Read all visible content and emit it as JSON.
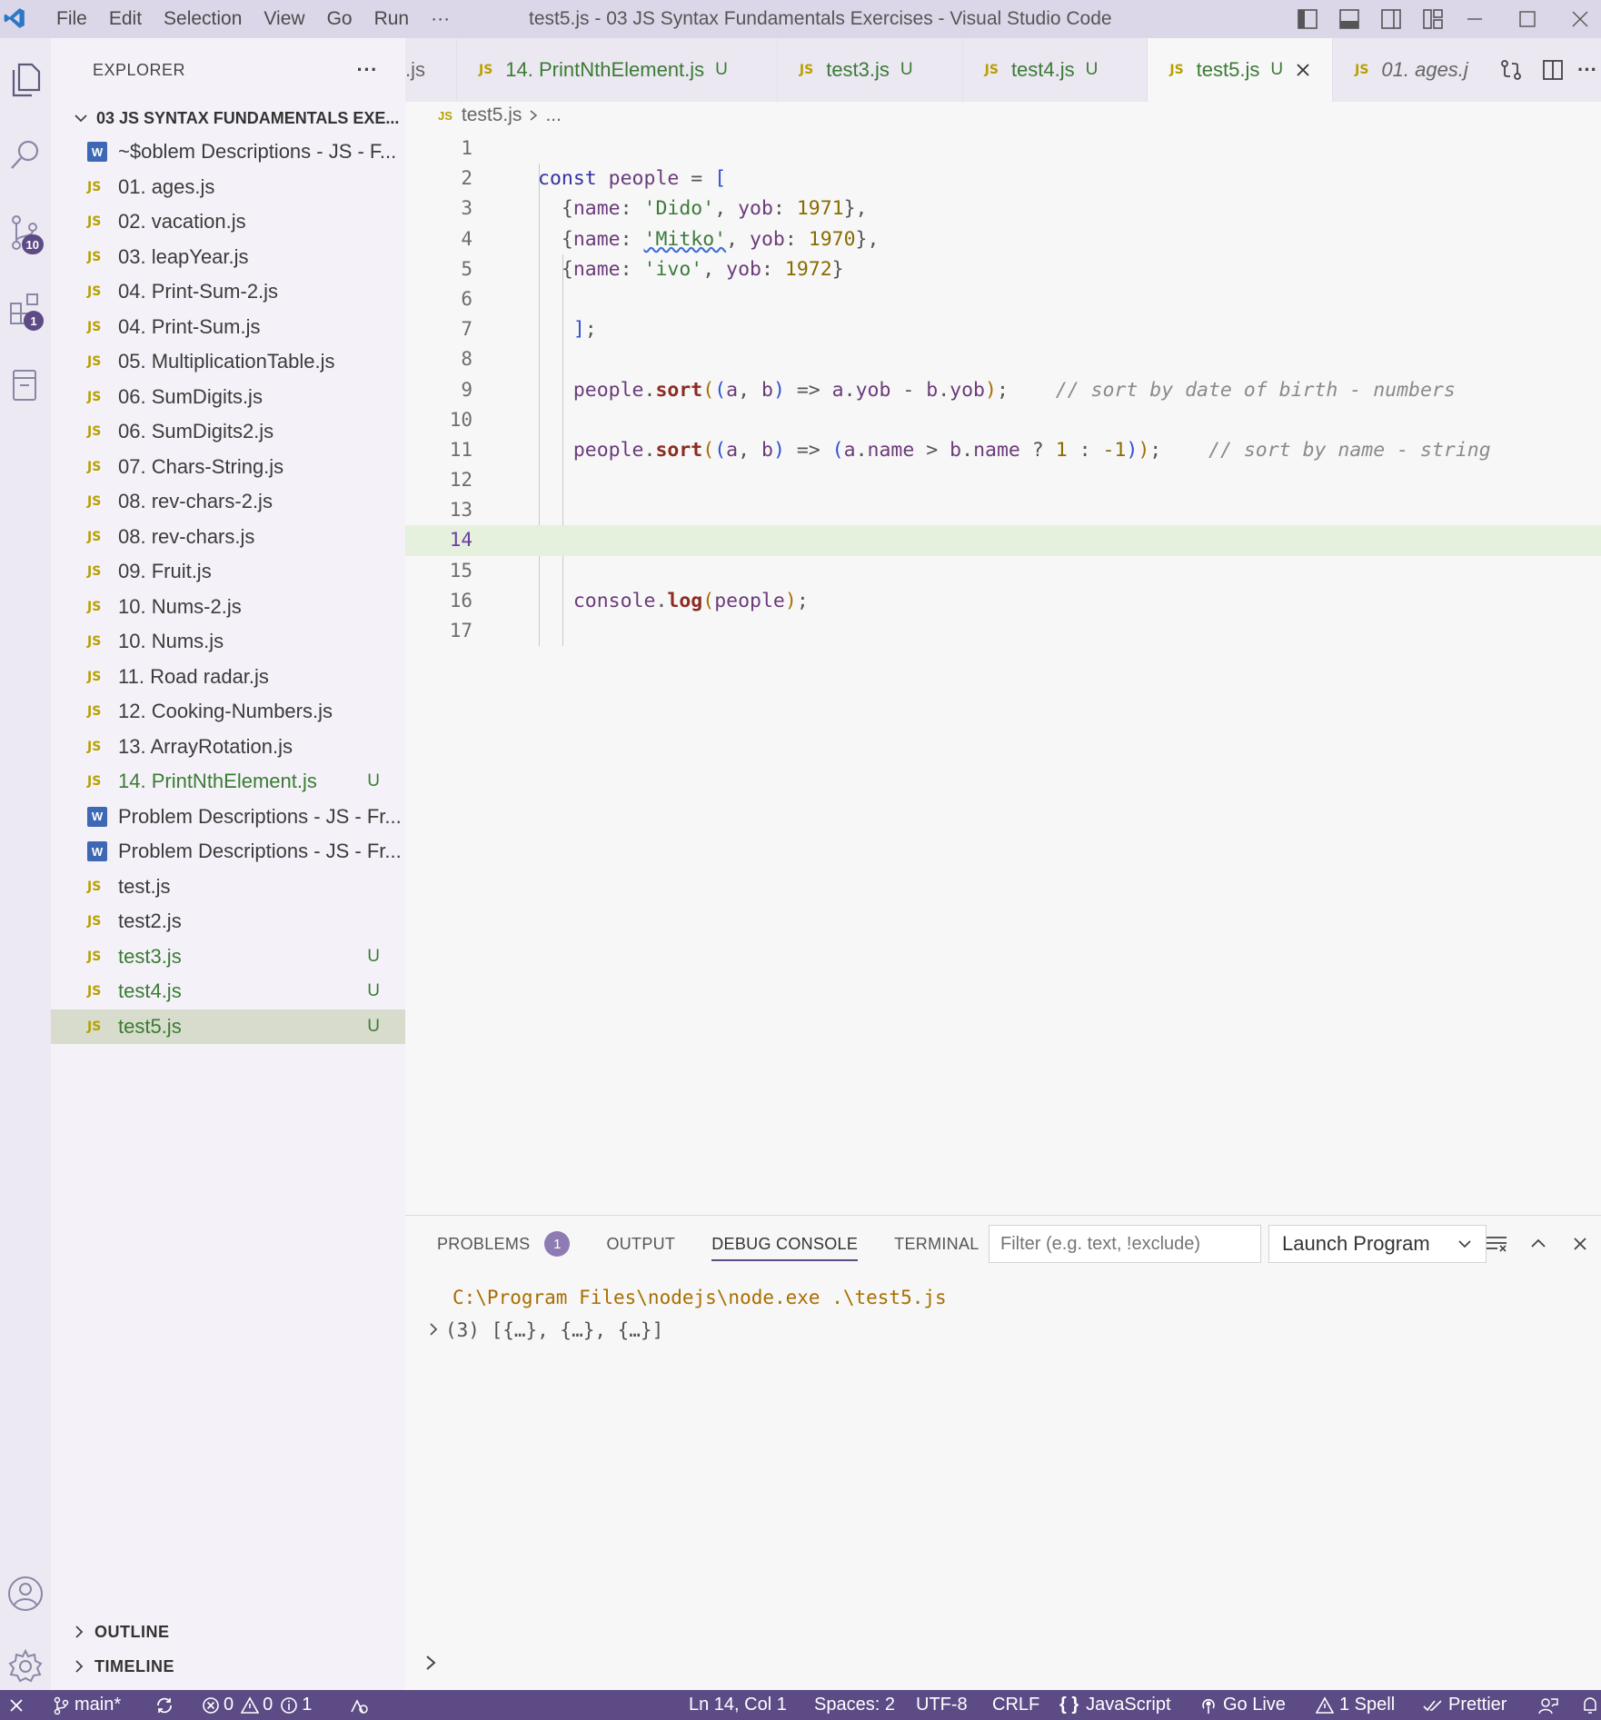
{
  "titlebar": {
    "menu": [
      "File",
      "Edit",
      "Selection",
      "View",
      "Go",
      "Run",
      "···"
    ],
    "title": "test5.js - 03 JS Syntax Fundamentals Exercises - Visual Studio Code"
  },
  "activity": {
    "scm_badge": "10",
    "extensions_badge": "1"
  },
  "sidebar": {
    "header": "EXPLORER",
    "more": "···",
    "folder": "03 JS SYNTAX FUNDAMENTALS EXE...",
    "files": [
      {
        "icon": "W",
        "name": "~$oblem Descriptions - JS - F...",
        "status": ""
      },
      {
        "icon": "JS",
        "name": "01. ages.js",
        "status": ""
      },
      {
        "icon": "JS",
        "name": "02. vacation.js",
        "status": ""
      },
      {
        "icon": "JS",
        "name": "03. leapYear.js",
        "status": ""
      },
      {
        "icon": "JS",
        "name": "04. Print-Sum-2.js",
        "status": ""
      },
      {
        "icon": "JS",
        "name": "04. Print-Sum.js",
        "status": ""
      },
      {
        "icon": "JS",
        "name": "05. MultiplicationTable.js",
        "status": ""
      },
      {
        "icon": "JS",
        "name": "06. SumDigits.js",
        "status": ""
      },
      {
        "icon": "JS",
        "name": "06. SumDigits2.js",
        "status": ""
      },
      {
        "icon": "JS",
        "name": "07. Chars-String.js",
        "status": ""
      },
      {
        "icon": "JS",
        "name": "08. rev-chars-2.js",
        "status": ""
      },
      {
        "icon": "JS",
        "name": "08. rev-chars.js",
        "status": ""
      },
      {
        "icon": "JS",
        "name": "09. Fruit.js",
        "status": ""
      },
      {
        "icon": "JS",
        "name": "10. Nums-2.js",
        "status": ""
      },
      {
        "icon": "JS",
        "name": "10. Nums.js",
        "status": ""
      },
      {
        "icon": "JS",
        "name": "11. Road radar.js",
        "status": ""
      },
      {
        "icon": "JS",
        "name": "12. Cooking-Numbers.js",
        "status": ""
      },
      {
        "icon": "JS",
        "name": "13. ArrayRotation.js",
        "status": ""
      },
      {
        "icon": "JS",
        "name": "14. PrintNthElement.js",
        "status": "U"
      },
      {
        "icon": "W",
        "name": "Problem Descriptions - JS - Fr...",
        "status": ""
      },
      {
        "icon": "W",
        "name": "Problem Descriptions - JS - Fr...",
        "status": ""
      },
      {
        "icon": "JS",
        "name": "test.js",
        "status": ""
      },
      {
        "icon": "JS",
        "name": "test2.js",
        "status": ""
      },
      {
        "icon": "JS",
        "name": "test3.js",
        "status": "U"
      },
      {
        "icon": "JS",
        "name": "test4.js",
        "status": "U"
      },
      {
        "icon": "JS",
        "name": "test5.js",
        "status": "U"
      }
    ],
    "outline": "OUTLINE",
    "timeline": "TIMELINE"
  },
  "tabs": [
    {
      "name": ".js",
      "status": "",
      "active": false,
      "italic": false,
      "icon": ""
    },
    {
      "name": "14. PrintNthElement.js",
      "status": "U",
      "active": false,
      "italic": false,
      "icon": "JS"
    },
    {
      "name": "test3.js",
      "status": "U",
      "active": false,
      "italic": false,
      "icon": "JS"
    },
    {
      "name": "test4.js",
      "status": "U",
      "active": false,
      "italic": false,
      "icon": "JS"
    },
    {
      "name": "test5.js",
      "status": "U",
      "active": true,
      "italic": false,
      "icon": "JS"
    },
    {
      "name": "01. ages.j",
      "status": "",
      "active": false,
      "italic": true,
      "icon": "JS"
    }
  ],
  "breadcrumb": {
    "file": "test5.js",
    "rest": "..."
  },
  "code": [
    {
      "n": "1",
      "tokens": []
    },
    {
      "n": "2",
      "tokens": [
        [
          "kw",
          "const "
        ],
        [
          "id",
          "people"
        ],
        [
          "pu",
          " = "
        ],
        [
          "br",
          "["
        ]
      ]
    },
    {
      "n": "3",
      "tokens": [
        [
          "pu",
          "  {"
        ],
        [
          "id",
          "name"
        ],
        [
          "pu",
          ": "
        ],
        [
          "st",
          "'Dido'"
        ],
        [
          "pu",
          ", "
        ],
        [
          "id",
          "yob"
        ],
        [
          "pu",
          ": "
        ],
        [
          "nm",
          "1971"
        ],
        [
          "pu",
          "},"
        ]
      ]
    },
    {
      "n": "4",
      "tokens": [
        [
          "pu",
          "  {"
        ],
        [
          "id",
          "name"
        ],
        [
          "pu",
          ": "
        ],
        [
          "st",
          "'Mitko'"
        ],
        [
          "pu",
          ", "
        ],
        [
          "id",
          "yob"
        ],
        [
          "pu",
          ": "
        ],
        [
          "nm",
          "1970"
        ],
        [
          "pu",
          "},"
        ]
      ]
    },
    {
      "n": "5",
      "tokens": [
        [
          "pu",
          "  {"
        ],
        [
          "id",
          "name"
        ],
        [
          "pu",
          ": "
        ],
        [
          "st",
          "'ivo'"
        ],
        [
          "pu",
          ", "
        ],
        [
          "id",
          "yob"
        ],
        [
          "pu",
          ": "
        ],
        [
          "nm",
          "1972"
        ],
        [
          "pu",
          "}"
        ]
      ]
    },
    {
      "n": "6",
      "tokens": []
    },
    {
      "n": "7",
      "tokens": [
        [
          "br",
          "   ]"
        ],
        [
          "pu",
          ";"
        ]
      ]
    },
    {
      "n": "8",
      "tokens": []
    },
    {
      "n": "9",
      "tokens": [
        [
          "id",
          "   people"
        ],
        [
          "pu",
          "."
        ],
        [
          "fn",
          "sort"
        ],
        [
          "pa",
          "("
        ],
        [
          "br",
          "("
        ],
        [
          "id",
          "a"
        ],
        [
          "pu",
          ", "
        ],
        [
          "id",
          "b"
        ],
        [
          "br",
          ")"
        ],
        [
          "pu",
          " => "
        ],
        [
          "id",
          "a"
        ],
        [
          "pu",
          "."
        ],
        [
          "id",
          "yob"
        ],
        [
          "pu",
          " - "
        ],
        [
          "id",
          "b"
        ],
        [
          "pu",
          "."
        ],
        [
          "id",
          "yob"
        ],
        [
          "pa",
          ")"
        ],
        [
          "pu",
          ";"
        ],
        [
          "cm",
          "    // sort by date of birth - numbers"
        ]
      ]
    },
    {
      "n": "10",
      "tokens": []
    },
    {
      "n": "11",
      "tokens": [
        [
          "id",
          "   people"
        ],
        [
          "pu",
          "."
        ],
        [
          "fn",
          "sort"
        ],
        [
          "pa",
          "("
        ],
        [
          "br",
          "("
        ],
        [
          "id",
          "a"
        ],
        [
          "pu",
          ", "
        ],
        [
          "id",
          "b"
        ],
        [
          "br",
          ")"
        ],
        [
          "pu",
          " => "
        ],
        [
          "br",
          "("
        ],
        [
          "id",
          "a"
        ],
        [
          "pu",
          "."
        ],
        [
          "id",
          "name"
        ],
        [
          "pu",
          " > "
        ],
        [
          "id",
          "b"
        ],
        [
          "pu",
          "."
        ],
        [
          "id",
          "name"
        ],
        [
          "pu",
          " ? "
        ],
        [
          "nm",
          "1"
        ],
        [
          "pu",
          " : "
        ],
        [
          "nm",
          "-1"
        ],
        [
          "br",
          ")"
        ],
        [
          "pa",
          ")"
        ],
        [
          "pu",
          ";"
        ],
        [
          "cm",
          "    // sort by name - string"
        ]
      ]
    },
    {
      "n": "12",
      "tokens": []
    },
    {
      "n": "13",
      "tokens": []
    },
    {
      "n": "14",
      "tokens": [],
      "current": true
    },
    {
      "n": "15",
      "tokens": []
    },
    {
      "n": "16",
      "tokens": [
        [
          "id",
          "   console"
        ],
        [
          "pu",
          "."
        ],
        [
          "fn",
          "log"
        ],
        [
          "pa",
          "("
        ],
        [
          "id",
          "people"
        ],
        [
          "pa",
          ")"
        ],
        [
          "pu",
          ";"
        ]
      ]
    },
    {
      "n": "17",
      "tokens": []
    }
  ],
  "panel": {
    "tabs": {
      "problems": "PROBLEMS",
      "problems_count": "1",
      "output": "OUTPUT",
      "debug": "DEBUG CONSOLE",
      "terminal": "TERMINAL"
    },
    "filter_placeholder": "Filter (e.g. text, !exclude)",
    "launch": "Launch Program",
    "console_cmd": "C:\\Program Files\\nodejs\\node.exe .\\test5.js",
    "console_out": "(3) [{…}, {…}, {…}]"
  },
  "status": {
    "branch": "main*",
    "errors": "0",
    "warnings": "0",
    "info": "1",
    "position": "Ln 14, Col 1",
    "spaces": "Spaces: 2",
    "encoding": "UTF-8",
    "eol": "CRLF",
    "language": "JavaScript",
    "golive": "Go Live",
    "spell": "1 Spell",
    "prettier": "Prettier"
  },
  "colors": {
    "accent": "#5d4b86",
    "titlebar": "#dcd7e8",
    "current_line": "#e5f1dd"
  }
}
